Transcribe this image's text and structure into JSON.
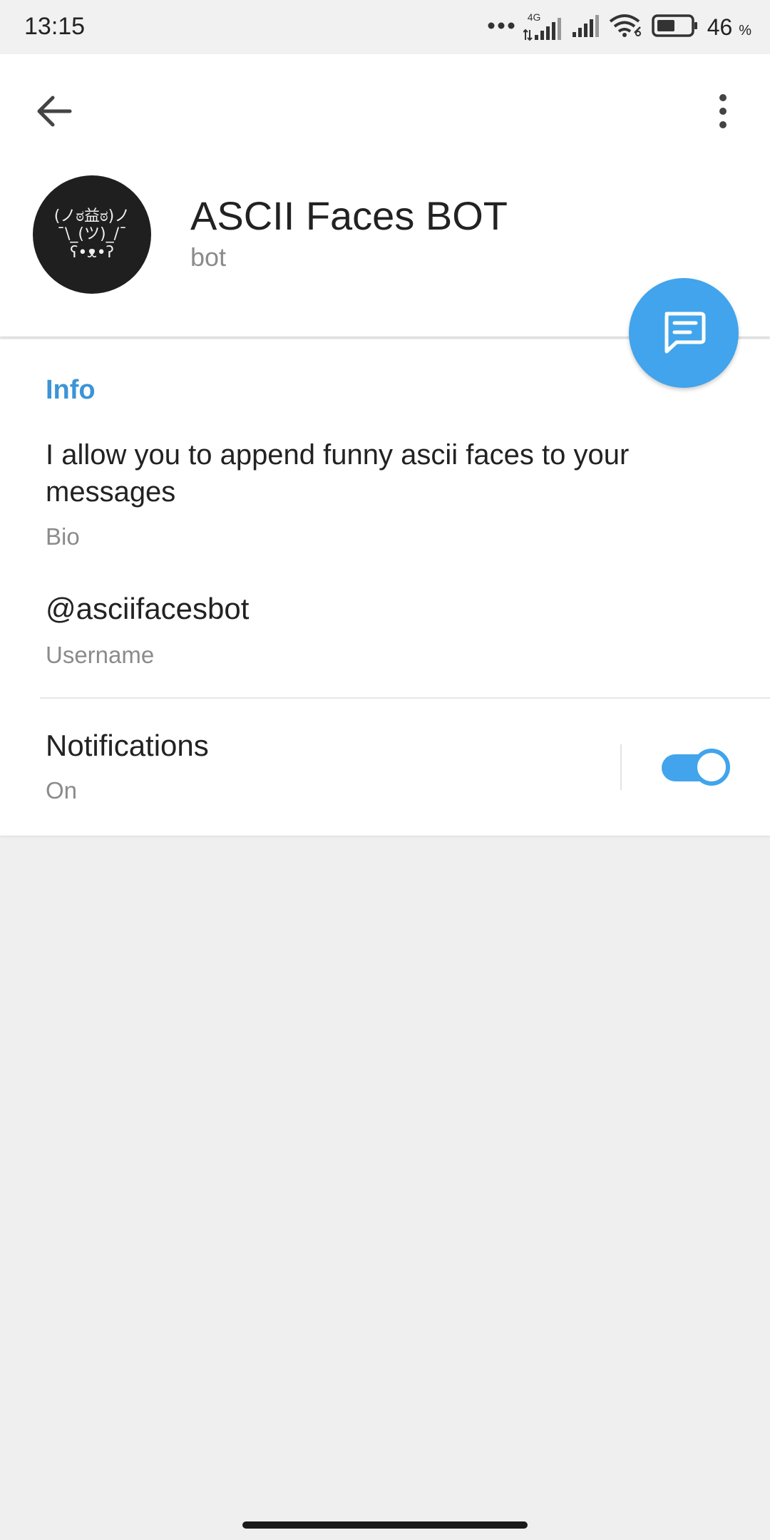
{
  "status_bar": {
    "time": "13:15",
    "network_label": "4G",
    "battery_percent": "46",
    "battery_unit": "%",
    "icons": [
      "more-dots-icon",
      "signal-4g-icon",
      "signal-icon",
      "wifi-icon",
      "battery-icon"
    ]
  },
  "header": {
    "back_icon": "arrow-left-icon",
    "menu_icon": "more-vertical-icon",
    "avatar_lines": [
      "(ノಠ益ಠ)ノ",
      "¯\\_(ツ)_/¯",
      "ʕ•ᴥ•ʔ"
    ],
    "name": "ASCII Faces BOT",
    "subtitle": "bot",
    "fab_icon": "message-icon"
  },
  "info": {
    "section_title": "Info",
    "bio_text": "I allow you to append funny ascii faces to your messages",
    "bio_label": "Bio",
    "username": "@asciifacesbot",
    "username_label": "Username",
    "notifications_title": "Notifications",
    "notifications_status": "On",
    "notifications_enabled": true
  },
  "colors": {
    "accent": "#41a4ec",
    "section_title": "#3d94d6",
    "background": "#efefef",
    "card": "#ffffff",
    "secondary_text": "#8b8b8b"
  }
}
